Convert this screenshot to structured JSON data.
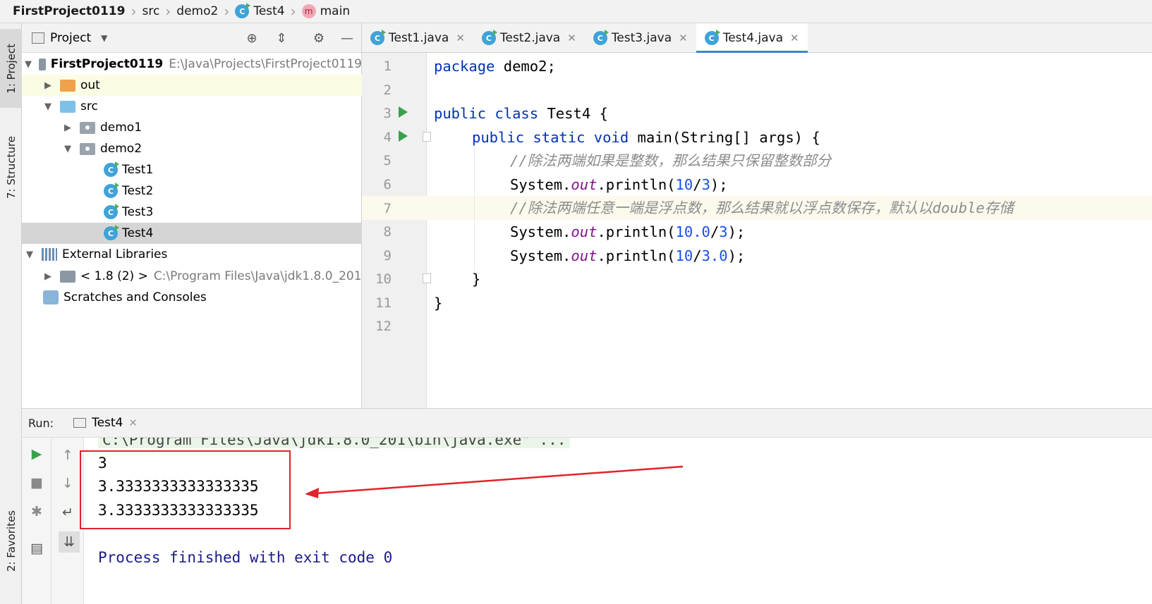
{
  "breadcrumb": {
    "project": "FirstProject0119",
    "src": "src",
    "package": "demo2",
    "class": "Test4",
    "method": "main",
    "class_badge": "C",
    "method_badge": "m"
  },
  "tool_windows": {
    "project": "1: Project",
    "structure": "7: Structure",
    "favorites": "2: Favorites"
  },
  "project_pane": {
    "title": "Project",
    "tree": {
      "root_name": "FirstProject0119",
      "root_path": "E:\\Java\\Projects\\FirstProject0119",
      "out": "out",
      "src": "src",
      "demo1": "demo1",
      "demo2": "demo2",
      "test1": "Test1",
      "test2": "Test2",
      "test3": "Test3",
      "test4": "Test4",
      "external_libraries": "External Libraries",
      "jdk_name": "< 1.8 (2) >",
      "jdk_path": "C:\\Program Files\\Java\\jdk1.8.0_201",
      "scratches": "Scratches and Consoles"
    }
  },
  "editor": {
    "tabs": [
      "Test1.java",
      "Test2.java",
      "Test3.java",
      "Test4.java"
    ],
    "active_tab": "Test4.java",
    "line_numbers": [
      "1",
      "2",
      "3",
      "4",
      "5",
      "6",
      "7",
      "8",
      "9",
      "10",
      "11",
      "12"
    ],
    "code": {
      "l1_kw": "package",
      "l1_rest": " demo2;",
      "l3_kw": "public class",
      "l3_rest": " Test4 {",
      "l4_kw": "public static void",
      "l4_rest": " main(String[] args) {",
      "l5_comment": "//除法两端如果是整数，那么结果只保留整数部分",
      "l6_pre": "System.",
      "l6_field": "out",
      "l6_mid": ".println(",
      "l6_n1": "10",
      "l6_op": "/",
      "l6_n2": "3",
      "l6_end": ");",
      "l7_comment": "//除法两端任意一端是浮点数，那么结果就以浮点数保存，默认以double存储",
      "l8_pre": "System.",
      "l8_field": "out",
      "l8_mid": ".println(",
      "l8_n1": "10.0",
      "l8_op": "/",
      "l8_n2": "3",
      "l8_end": ");",
      "l9_pre": "System.",
      "l9_field": "out",
      "l9_mid": ".println(",
      "l9_n1": "10",
      "l9_op": "/",
      "l9_n2": "3.0",
      "l9_end": ");",
      "l10": "}",
      "l11": "}"
    }
  },
  "run_panel": {
    "label": "Run:",
    "tab": "Test4",
    "console": {
      "command": "C:\\Program Files\\Java\\jdk1.8.0_201\\bin\\java.exe\" ...",
      "out1": "3",
      "out2": "3.3333333333333335",
      "out3": "3.3333333333333335",
      "finish": "Process finished with exit code 0"
    }
  },
  "colors": {
    "keyword": "#0033b3",
    "number": "#1750eb",
    "field": "#871094",
    "comment": "#8c8c8c",
    "annotation": "#e0242a",
    "active_tab_underline": "#4083c9"
  }
}
